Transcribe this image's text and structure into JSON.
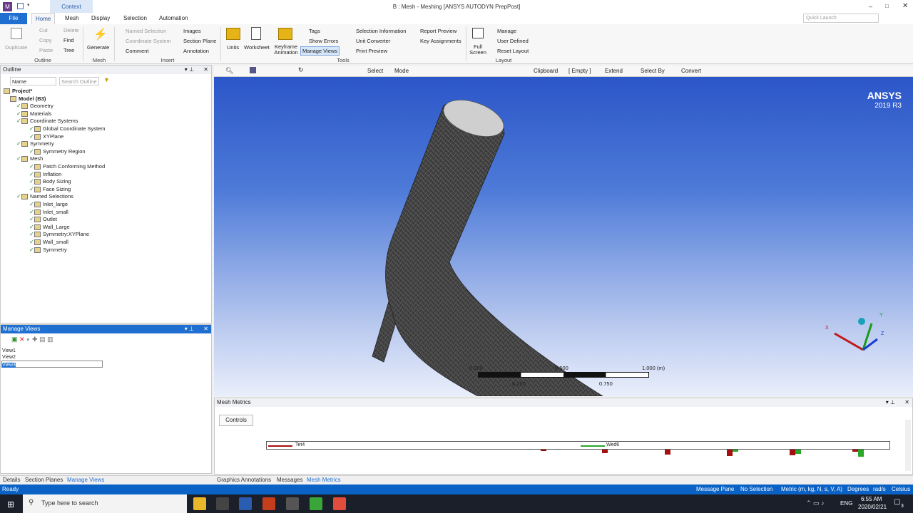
{
  "title": {
    "text": "B : Mesh - Meshing [ANSYS AUTODYN PrepPost]",
    "context": "Context",
    "quick_launch": "Quick Launch"
  },
  "tabs": [
    "File",
    "Home",
    "Mesh",
    "Display",
    "Selection",
    "Automation"
  ],
  "ribbon": {
    "outline": {
      "duplicate": "Duplicate",
      "cut": "Cut",
      "copy": "Copy",
      "paste": "Paste",
      "delete": "Delete",
      "find": "Find",
      "tree": "Tree",
      "group": "Outline"
    },
    "mesh": {
      "generate": "Generate",
      "group": "Mesh"
    },
    "insert": {
      "named_selection": "Named Selection",
      "coordinate_system": "Coordinate System",
      "comment": "Comment",
      "images": "Images",
      "section_plane": "Section Plane",
      "annotation": "Annotation",
      "group": "Insert"
    },
    "tools": {
      "units": "Units",
      "worksheet": "Worksheet",
      "keyframe": "Keyframe Animation",
      "tags": "Tags",
      "show_errors": "Show Errors",
      "manage_views": "Manage Views",
      "selection_information": "Selection Information",
      "unit_converter": "Unit Converter",
      "print_preview": "Print Preview",
      "report_preview": "Report Preview",
      "key_assignments": "Key Assignments",
      "group": "Tools"
    },
    "layout": {
      "full_screen": "Full Screen",
      "manage": "Manage",
      "user_defined": "User Defined",
      "reset_layout": "Reset Layout",
      "group": "Layout"
    }
  },
  "outline": {
    "title": "Outline",
    "filter_label": "Name",
    "search_placeholder": "Search Outline",
    "tree": [
      {
        "label": "Project*",
        "level": 0
      },
      {
        "label": "Model (B3)",
        "level": 1
      },
      {
        "label": "Geometry",
        "level": 2
      },
      {
        "label": "Materials",
        "level": 2
      },
      {
        "label": "Coordinate Systems",
        "level": 2
      },
      {
        "label": "Global Coordinate System",
        "level": 3
      },
      {
        "label": "XYPlane",
        "level": 3
      },
      {
        "label": "Symmetry",
        "level": 2
      },
      {
        "label": "Symmetry Region",
        "level": 3
      },
      {
        "label": "Mesh",
        "level": 2
      },
      {
        "label": "Patch Conforming Method",
        "level": 3
      },
      {
        "label": "Inflation",
        "level": 3
      },
      {
        "label": "Body Sizing",
        "level": 3
      },
      {
        "label": "Face Sizing",
        "level": 3
      },
      {
        "label": "Named Selections",
        "level": 2
      },
      {
        "label": "Inlet_large",
        "level": 3
      },
      {
        "label": "Inlet_small",
        "level": 3
      },
      {
        "label": "Outlet",
        "level": 3
      },
      {
        "label": "Wall_Large",
        "level": 3
      },
      {
        "label": "Symmetry:XYPlane",
        "level": 3
      },
      {
        "label": "Wall_small",
        "level": 3
      },
      {
        "label": "Symmetry",
        "level": 3
      }
    ]
  },
  "manage_views": {
    "title": "Manage Views",
    "views": [
      "View1",
      "View2",
      "View3"
    ]
  },
  "graphics_toolbar": {
    "select": "Select",
    "mode": "Mode",
    "clipboard": "Clipboard",
    "empty": "[ Empty ]",
    "extend": "Extend",
    "select_by": "Select By",
    "convert": "Convert"
  },
  "viewport": {
    "brand": "ANSYS",
    "version": "2019 R3",
    "scale": {
      "ticks": [
        "0.000",
        "0.500",
        "1.000 (m)"
      ],
      "sub_ticks": [
        "0.250",
        "0.750"
      ]
    },
    "axes": {
      "x": "X",
      "y": "Y",
      "z": "Z"
    }
  },
  "mesh_metrics": {
    "title": "Mesh Metrics",
    "controls": "Controls",
    "legend": [
      "Tet4",
      "Wed6"
    ],
    "colors": {
      "tet4": "#a50f0f",
      "wed6": "#2aa82a"
    }
  },
  "bottom_tabs_left": [
    "Details",
    "Section Planes",
    "Manage Views"
  ],
  "bottom_tabs_right": [
    "Graphics Annotations",
    "Messages",
    "Mesh Metrics"
  ],
  "status": {
    "ready": "Ready",
    "message_pane": "Message Pane",
    "no_selection": "No Selection",
    "metric": "Metric (m, kg, N, s, V, A)",
    "degrees": "Degrees",
    "rads": "rad/s",
    "celsius": "Celsius"
  },
  "taskbar": {
    "search": "Type here to search",
    "lang": "ENG",
    "time": "6:55 AM",
    "date": "2020/02/21",
    "notif": "3"
  }
}
